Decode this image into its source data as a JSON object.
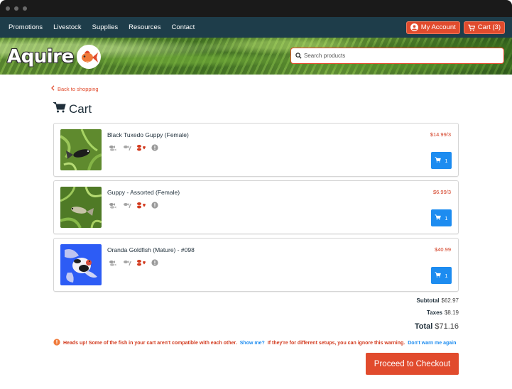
{
  "nav": {
    "links": [
      "Promotions",
      "Livestock",
      "Supplies",
      "Resources",
      "Contact"
    ],
    "account_label": "My Account",
    "cart_label": "Cart (3)"
  },
  "header": {
    "logo_text": "Aquire",
    "search_placeholder": "Search products"
  },
  "page": {
    "back_label": "Back to shopping",
    "title": "Cart"
  },
  "cart": {
    "items": [
      {
        "name": "Black Tuxedo Guppy (Female)",
        "price": "$14.99/3",
        "qty": "1",
        "thumb_icon": "guppy-photo"
      },
      {
        "name": "Guppy - Assorted (Female)",
        "price": "$6.99/3",
        "qty": "1",
        "thumb_icon": "guppy-photo"
      },
      {
        "name": "Oranda Goldfish (Mature) - #098",
        "price": "$40.99",
        "qty": "1",
        "thumb_icon": "goldfish-photo"
      }
    ],
    "compat_icons": [
      "fish-school-icon",
      "plant-icon",
      "fish-heart-icon",
      "info-icon"
    ]
  },
  "totals": {
    "subtotal_label": "Subtotal",
    "subtotal": "$62.97",
    "taxes_label": "Taxes",
    "taxes": "$8.19",
    "total_label": "Total",
    "total": "$71.16"
  },
  "warning": {
    "text": "Heads up! Some of the fish in your cart aren't compatible with each other.",
    "show_me": "Show me?",
    "text2": "If they're for different setups, you can ignore this warning.",
    "dont_warn": "Don't warn me again"
  },
  "checkout_label": "Proceed to Checkout",
  "colors": {
    "accent": "#e14b2d",
    "nav_bg": "#1e3d4a",
    "qty_blue": "#1d8cf0",
    "price_red": "#d23a1e"
  }
}
